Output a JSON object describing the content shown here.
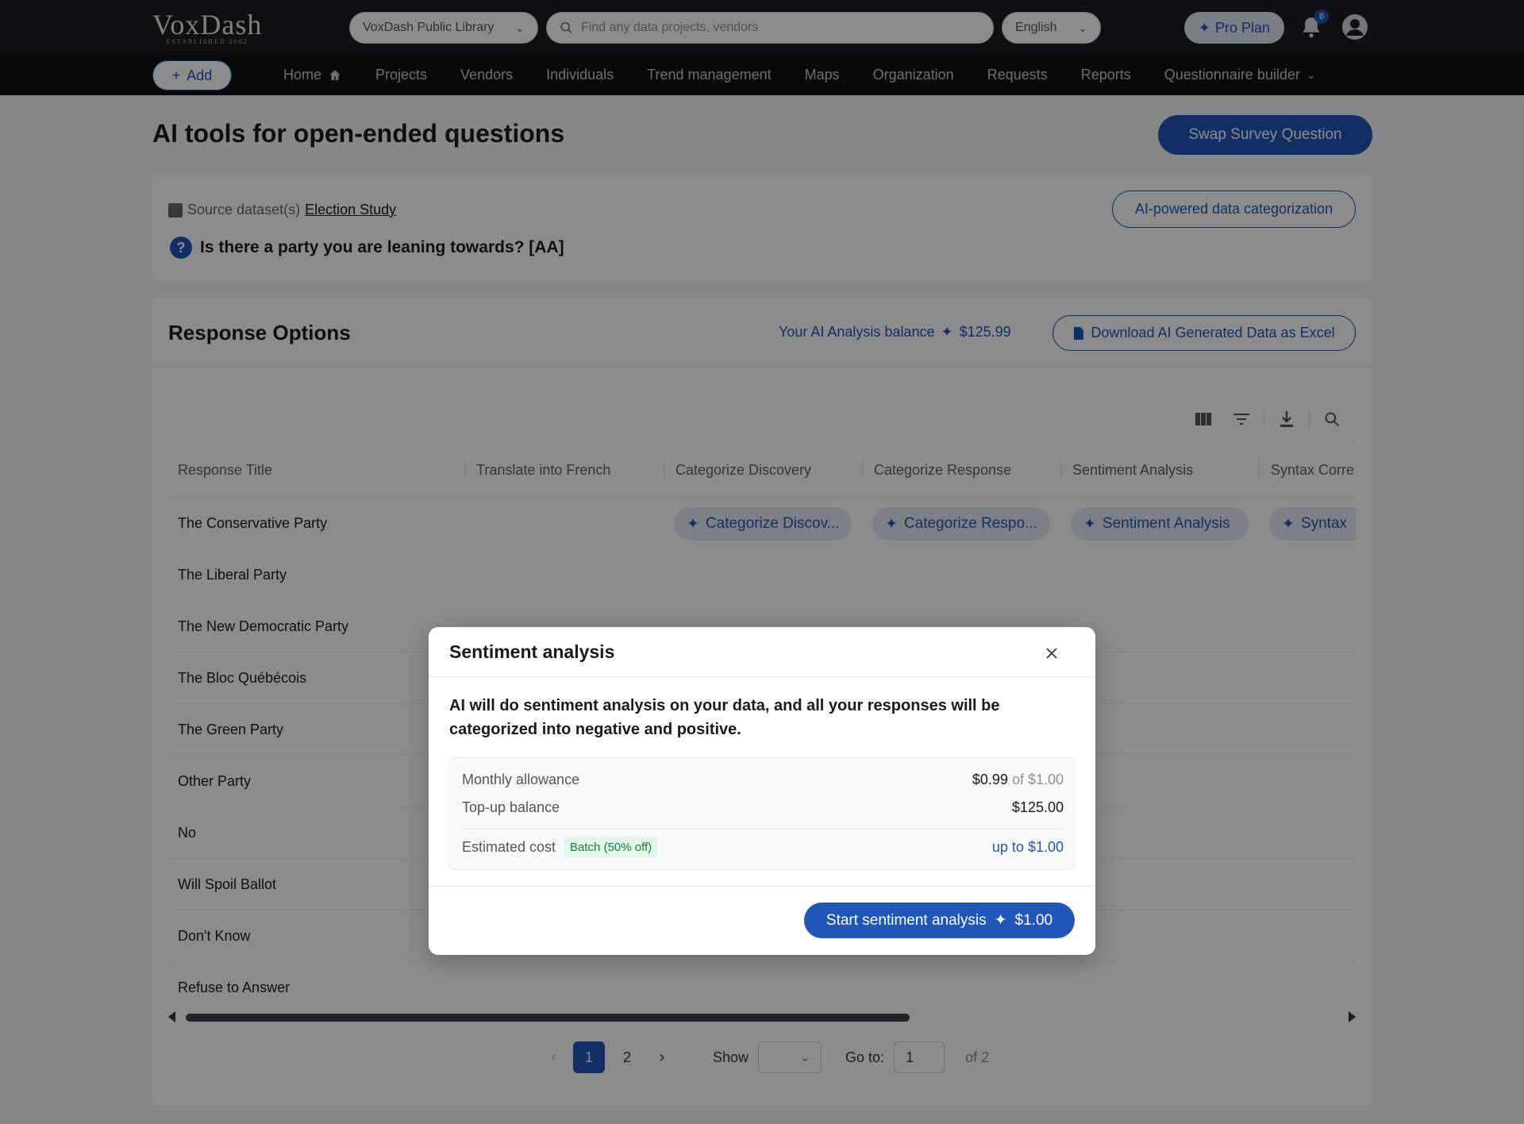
{
  "brand": {
    "name": "VoxDash",
    "tagline": "ESTABLISHED 2002"
  },
  "header": {
    "library_select": "VoxDash Public Library",
    "search_placeholder": "Find any data projects, vendors",
    "language_select": "English",
    "pro_plan_label": "Pro Plan",
    "notification_count": "8"
  },
  "nav": {
    "add_label": "Add",
    "items": [
      {
        "label": "Home"
      },
      {
        "label": "Projects"
      },
      {
        "label": "Vendors"
      },
      {
        "label": "Individuals"
      },
      {
        "label": "Trend management"
      },
      {
        "label": "Maps"
      },
      {
        "label": "Organization"
      },
      {
        "label": "Requests"
      },
      {
        "label": "Reports"
      },
      {
        "label": "Questionnaire builder"
      }
    ]
  },
  "page": {
    "title": "AI tools for open-ended questions",
    "swap_button": "Swap Survey Question",
    "source_label": "Source dataset(s)",
    "source_link": "Election Study",
    "question": "Is there a party you are leaning towards? [AA]",
    "categorization_button": "AI-powered data categorization"
  },
  "responses": {
    "title": "Response Options",
    "balance_label": "Your AI Analysis balance",
    "balance_value": "$125.99",
    "download_button": "Download AI Generated Data as Excel",
    "columns": [
      "Response Title",
      "Translate into French",
      "Categorize Discovery",
      "Categorize Response",
      "Sentiment Analysis",
      "Syntax Corre"
    ],
    "first_row_chips": {
      "categorize_discovery": "Categorize Discov...",
      "categorize_response": "Categorize Respo...",
      "sentiment_analysis": "Sentiment Analysis",
      "syntax": "Syntax"
    },
    "rows": [
      "The Conservative Party",
      "The Liberal Party",
      "The New Democratic Party",
      "The Bloc Québécois",
      "The Green Party",
      "Other Party",
      "No",
      "Will Spoil Ballot",
      "Don't Know",
      "Refuse to Answer"
    ]
  },
  "pagination": {
    "pages": [
      "1",
      "2"
    ],
    "current_page": "1",
    "show_label": "Show",
    "goto_label": "Go to:",
    "goto_value": "1",
    "of_label": "of 2"
  },
  "modal": {
    "title": "Sentiment analysis",
    "description": "AI will do sentiment analysis on your data, and all your responses will be categorized into negative and positive.",
    "monthly_allowance_label": "Monthly allowance",
    "monthly_allowance_value": "$0.99",
    "monthly_allowance_of": "of $1.00",
    "topup_label": "Top-up balance",
    "topup_value": "$125.00",
    "estimated_cost_label": "Estimated cost",
    "batch_badge": "Batch (50% off)",
    "estimated_cost_value": "up to $1.00",
    "start_button_label": "Start sentiment analysis",
    "start_button_price": "$1.00"
  },
  "colors": {
    "accent": "#1f56b8",
    "topbar": "#1a1c21",
    "badge_green": "#15803d"
  }
}
